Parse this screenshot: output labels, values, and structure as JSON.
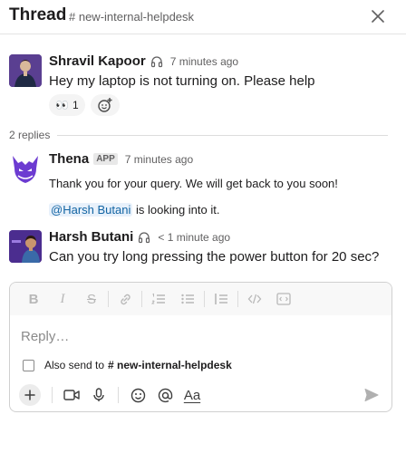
{
  "header": {
    "title": "Thread",
    "channel": "# new-internal-helpdesk"
  },
  "parent_message": {
    "sender": "Shravil Kapoor",
    "timestamp": "7 minutes ago",
    "text": "Hey my laptop is not turning on. Please help",
    "reaction": {
      "emoji": "👀",
      "count": "1"
    }
  },
  "replies_label": "2 replies",
  "replies": [
    {
      "sender": "Thena",
      "badge": "APP",
      "timestamp": "7 minutes ago",
      "text": "Thank you for your query. We will get back to you soon!",
      "mention": "@Harsh Butani",
      "mention_suffix": " is looking into it."
    },
    {
      "sender": "Harsh Butani",
      "timestamp": "< 1 minute ago",
      "text": "Can you try long pressing the power button for 20 sec?"
    }
  ],
  "composer": {
    "placeholder": "Reply…",
    "also_send_prefix": "Also send to",
    "also_send_channel": "# new-internal-helpdesk",
    "format_label": "Aa"
  },
  "colors": {
    "avatar_shravil": "#5a3f91",
    "thena_purple": "#6c3bd1",
    "avatar_harsh": "#4b2d8f",
    "mention_bg": "#e8f1fb",
    "mention_text": "#1264a3"
  }
}
